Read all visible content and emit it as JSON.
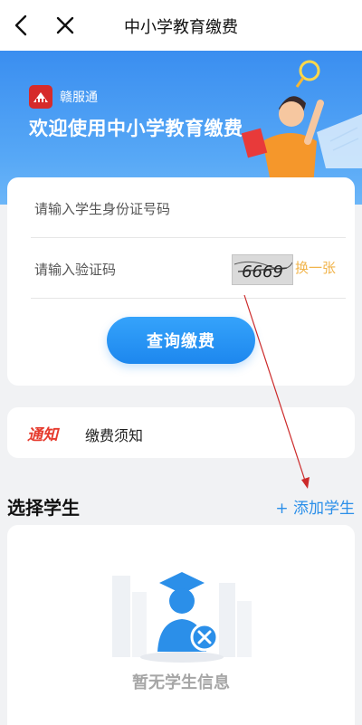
{
  "header": {
    "title": "中小学教育缴费",
    "back_icon": "back-arrow-icon",
    "close_icon": "close-icon"
  },
  "banner": {
    "brand_name": "赣服通",
    "welcome": "欢迎使用中小学教育缴费"
  },
  "form": {
    "id_placeholder": "请输入学生身份证号码",
    "captcha_placeholder": "请输入验证码",
    "captcha_text": "6669",
    "refresh_label": "换一张",
    "query_button": "查询缴费"
  },
  "notice": {
    "tag": "通知",
    "text": "缴费须知"
  },
  "students": {
    "section_title": "选择学生",
    "add_label": "+ 添加学生",
    "empty_text": "暂无学生信息"
  },
  "colors": {
    "accent": "#2b8fe9",
    "notice_red": "#e63b2e",
    "refresh_orange": "#f1b44b"
  }
}
